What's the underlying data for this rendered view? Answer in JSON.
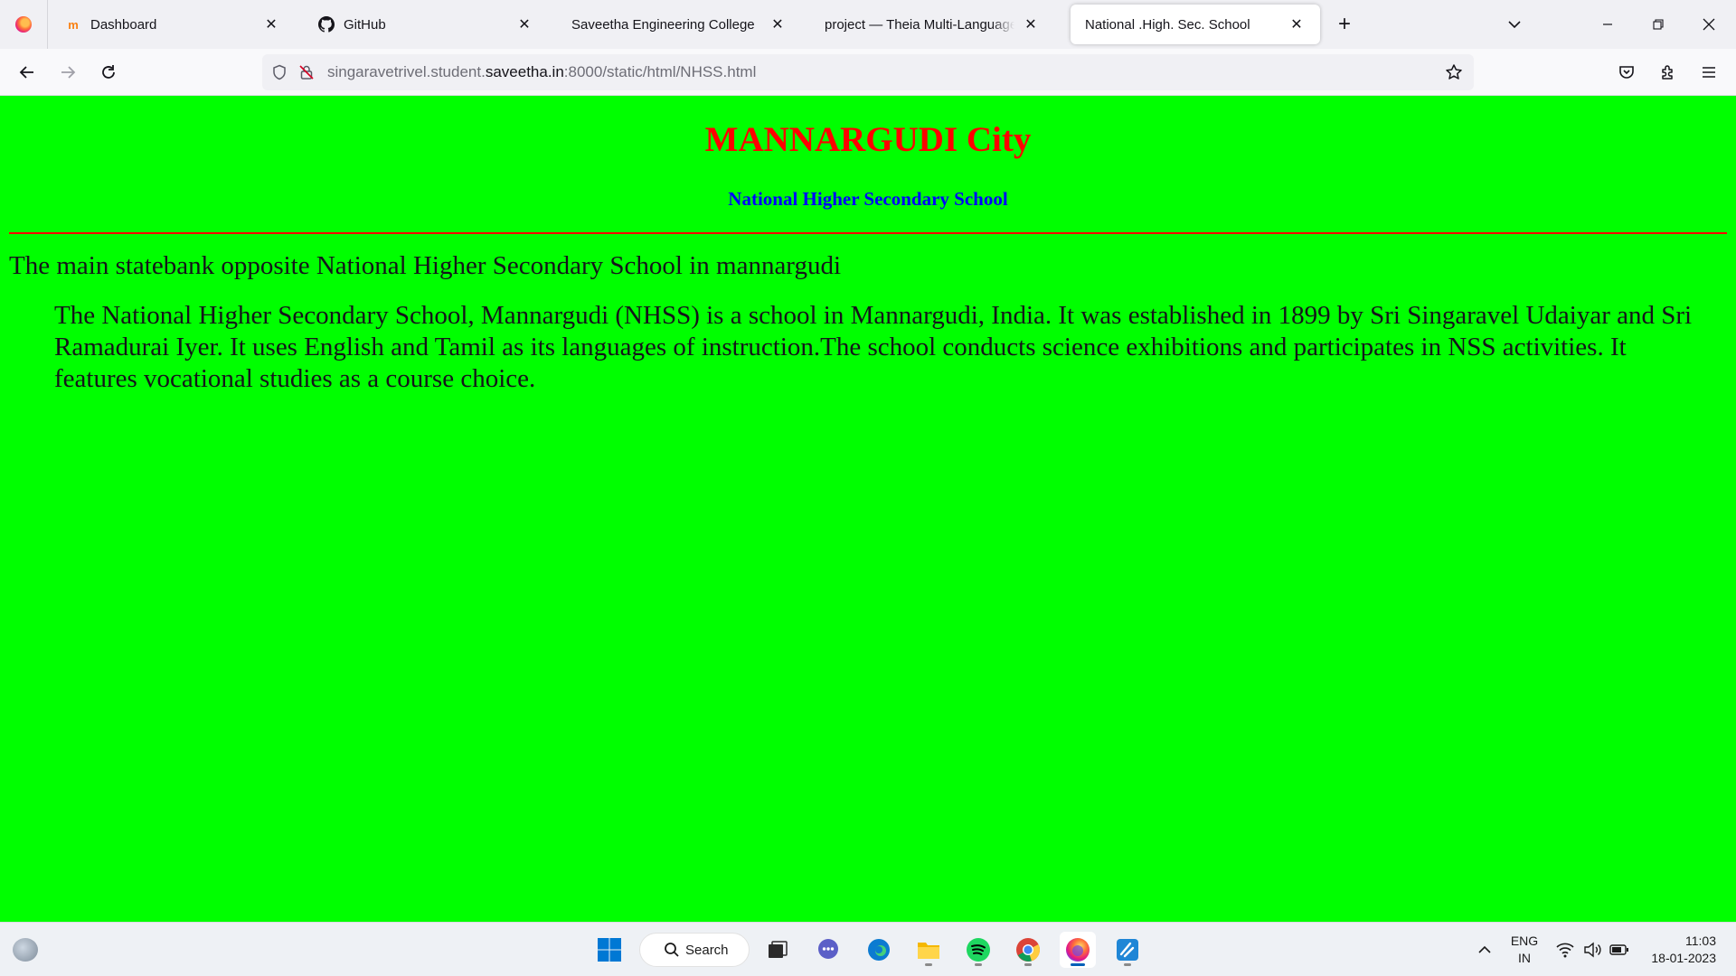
{
  "browser": {
    "tabs": [
      {
        "label": "Dashboard",
        "icon": "moodle-icon"
      },
      {
        "label": "GitHub",
        "icon": "github-icon"
      },
      {
        "label": "Saveetha Engineering College",
        "icon": ""
      },
      {
        "label": "project — Theia Multi-Language Ex",
        "icon": ""
      },
      {
        "label": "National .High. Sec. School",
        "icon": ""
      }
    ],
    "active_tab": 4,
    "url_prefix": "singaravetrivel.student.",
    "url_host": "saveetha.in",
    "url_suffix": ":8000/static/html/NHSS.html"
  },
  "page": {
    "title": "MANNARGUDI City",
    "subtitle": "National Higher Secondary School",
    "lead": "The main statebank opposite National Higher Secondary School in mannargudi",
    "body": "The National Higher Secondary School, Mannargudi (NHSS) is a school in Mannargudi, India. It was established in 1899 by Sri Singaravel Udaiyar and Sri Ramadurai Iyer. It uses English and Tamil as its languages of instruction.The school conducts science exhibitions and participates in NSS activities. It features vocational studies as a course choice.",
    "background_color": "#00ff00",
    "title_color": "#ff0000",
    "subtitle_color": "#0000ff"
  },
  "taskbar": {
    "search_label": "Search",
    "lang_line1": "ENG",
    "lang_line2": "IN",
    "time": "11:03",
    "date": "18-01-2023"
  }
}
